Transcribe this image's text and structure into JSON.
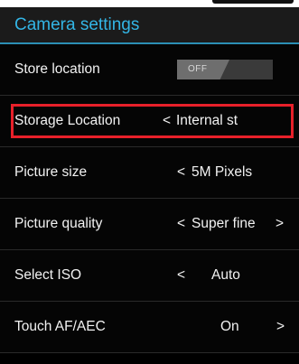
{
  "header": {
    "title": "Camera settings"
  },
  "rows": [
    {
      "label": "Store location",
      "toggle": "OFF"
    },
    {
      "label": "Storage Location",
      "prefix": "<",
      "value": "Internal st"
    },
    {
      "label": "Picture size",
      "prefix": "<",
      "value": "5M Pixels"
    },
    {
      "label": "Picture quality",
      "prefix": "<",
      "value": "Super fine",
      "suffix": ">"
    },
    {
      "label": "Select ISO",
      "prefix": "<",
      "value": "Auto"
    },
    {
      "label": "Touch AF/AEC",
      "value": "On",
      "suffix": ">"
    }
  ],
  "colors": {
    "accent": "#33b5e5",
    "highlight": "#e8202a",
    "background": "#000000"
  }
}
